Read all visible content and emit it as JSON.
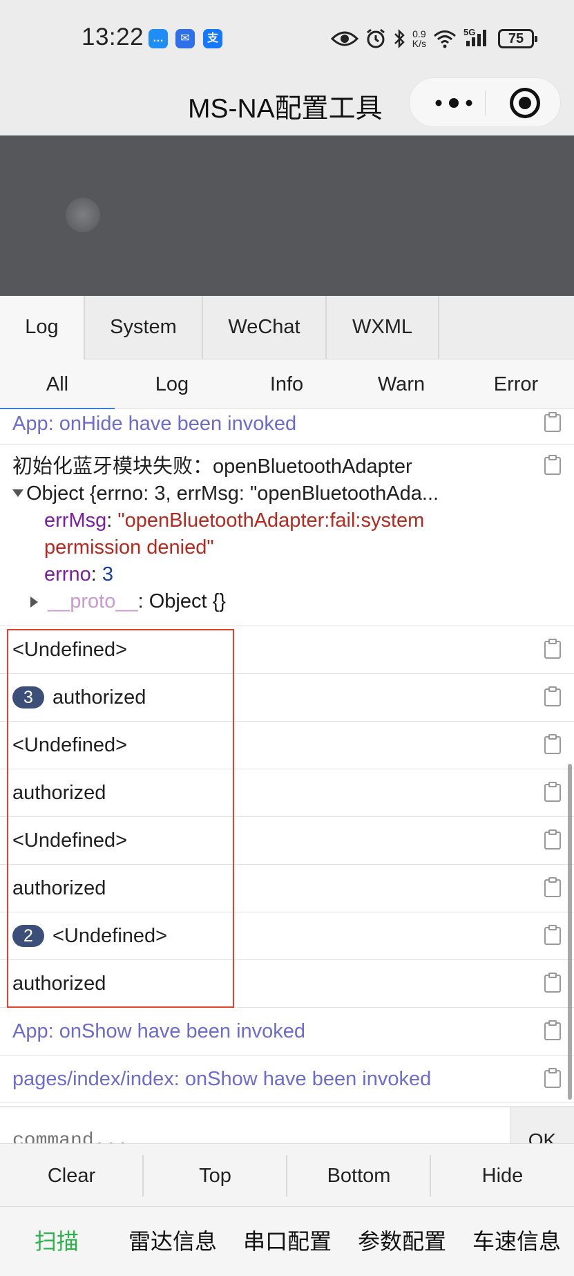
{
  "status_bar": {
    "time": "13:22",
    "notification_apps": [
      {
        "name": "chat-app-icon",
        "color": "#1f8df6",
        "glyph": "💬"
      },
      {
        "name": "mail-app-icon",
        "color": "#2f6fe8",
        "glyph": "✉"
      },
      {
        "name": "alipay-app-icon",
        "color": "#1677ff",
        "glyph": "支"
      }
    ],
    "net_speed_value": "0.9",
    "net_speed_unit": "K/s",
    "network_type": "5G",
    "battery": "75"
  },
  "nav": {
    "title": "MS-NA配置工具"
  },
  "vconsole": {
    "tabs": [
      "Log",
      "System",
      "WeChat",
      "WXML"
    ],
    "active_tab": "Log",
    "filters": [
      "All",
      "Log",
      "Info",
      "Warn",
      "Error"
    ],
    "active_filter": "All",
    "logs": {
      "onhide": "App: onHide have been invoked",
      "bt_error_title": "初始化蓝牙模块失败：openBluetoothAdapter",
      "bt_error_object": "Object {errno: 3, errMsg: \"openBluetoothAda...",
      "errmsg_key": "errMsg",
      "errmsg_value_line1": "\"openBluetoothAdapter:fail:system",
      "errmsg_value_line2": "permission denied\"",
      "errno_key": "errno",
      "errno_value": "3",
      "proto_key": "__proto__",
      "proto_value": ": Object {}",
      "row1": "<Undefined>",
      "row2_count": "3",
      "row2": "authorized",
      "row3": "<Undefined>",
      "row4": "authorized",
      "row5": "<Undefined>",
      "row6": "authorized",
      "row7_count": "2",
      "row7": "<Undefined>",
      "row8": "authorized",
      "onshow": "App: onShow have been invoked",
      "page_onshow": "pages/index/index: onShow have been invoked"
    },
    "command_placeholder": "command...",
    "ok_label": "OK",
    "tools": [
      "Clear",
      "Top",
      "Bottom",
      "Hide"
    ]
  },
  "bottom_nav": {
    "items": [
      "扫描",
      "雷达信息",
      "串口配置",
      "参数配置",
      "车速信息"
    ],
    "active": "扫描",
    "active_color": "#2bb24c"
  },
  "colors": {
    "highlight_box": "#e5412d",
    "info_text": "#6b6bd0",
    "badge": "#3c4f78"
  }
}
